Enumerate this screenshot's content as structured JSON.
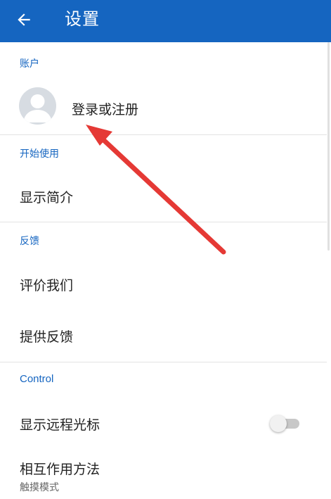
{
  "appbar": {
    "title": "设置",
    "back_icon": "arrow-left-icon",
    "color": "#1565c0"
  },
  "sections": {
    "account": {
      "header": "账户",
      "login_label": "登录或注册",
      "avatar_icon": "user-avatar-icon"
    },
    "getting_started": {
      "header": "开始使用",
      "intro_label": "显示简介"
    },
    "feedback": {
      "header": "反馈",
      "rate_label": "评价我们",
      "feedback_label": "提供反馈"
    },
    "control": {
      "header": "Control",
      "remote_cursor_label": "显示远程光标",
      "remote_cursor_enabled": false,
      "interaction_label": "相互作用方法",
      "interaction_value": "触摸模式"
    }
  },
  "annotation": {
    "arrow_color": "#e53935"
  }
}
